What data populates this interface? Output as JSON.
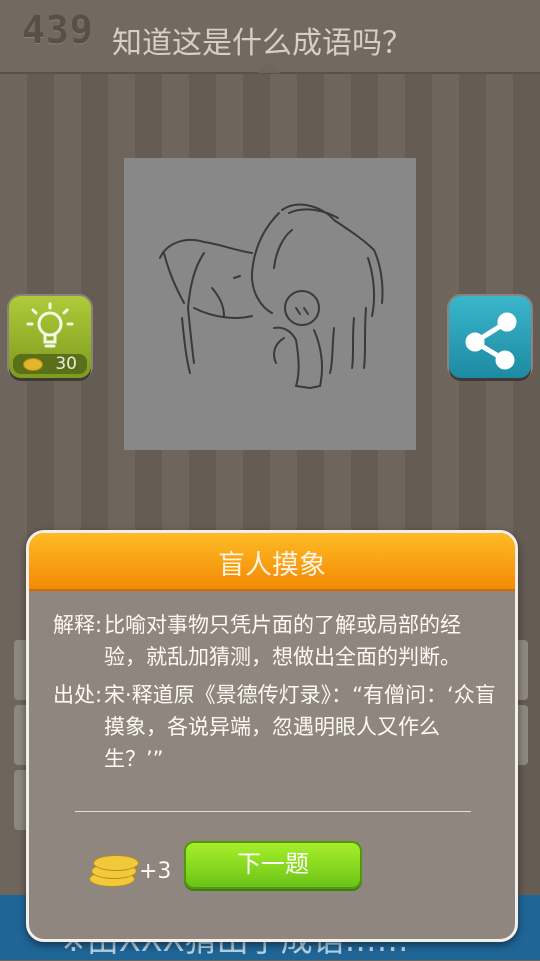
{
  "header": {
    "level": "439",
    "question": "知道这是什么成语吗？"
  },
  "hint_button": {
    "icon": "lightbulb-icon",
    "cost": "30",
    "color": "#9dbc30"
  },
  "share_button": {
    "icon": "share-icon",
    "color": "#2ea3bc"
  },
  "bottom_banner": {
    "ticker": "※由XXX猜出了成语……"
  },
  "dialog": {
    "title": "盲人摸象",
    "explain_label": "解释:",
    "explain_text": "比喻对事物只凭片面的了解或局部的经验，就乱加猜测，想做出全面的判断。",
    "source_label": "出处:",
    "source_text": "宋·释道原《景德传灯录》：“有僧问：‘众盲摸象，各说异端，忽遇明眼人又作么生？’”",
    "reward": "+3",
    "next_label": "下一题",
    "accent_color": "#f8a012"
  }
}
